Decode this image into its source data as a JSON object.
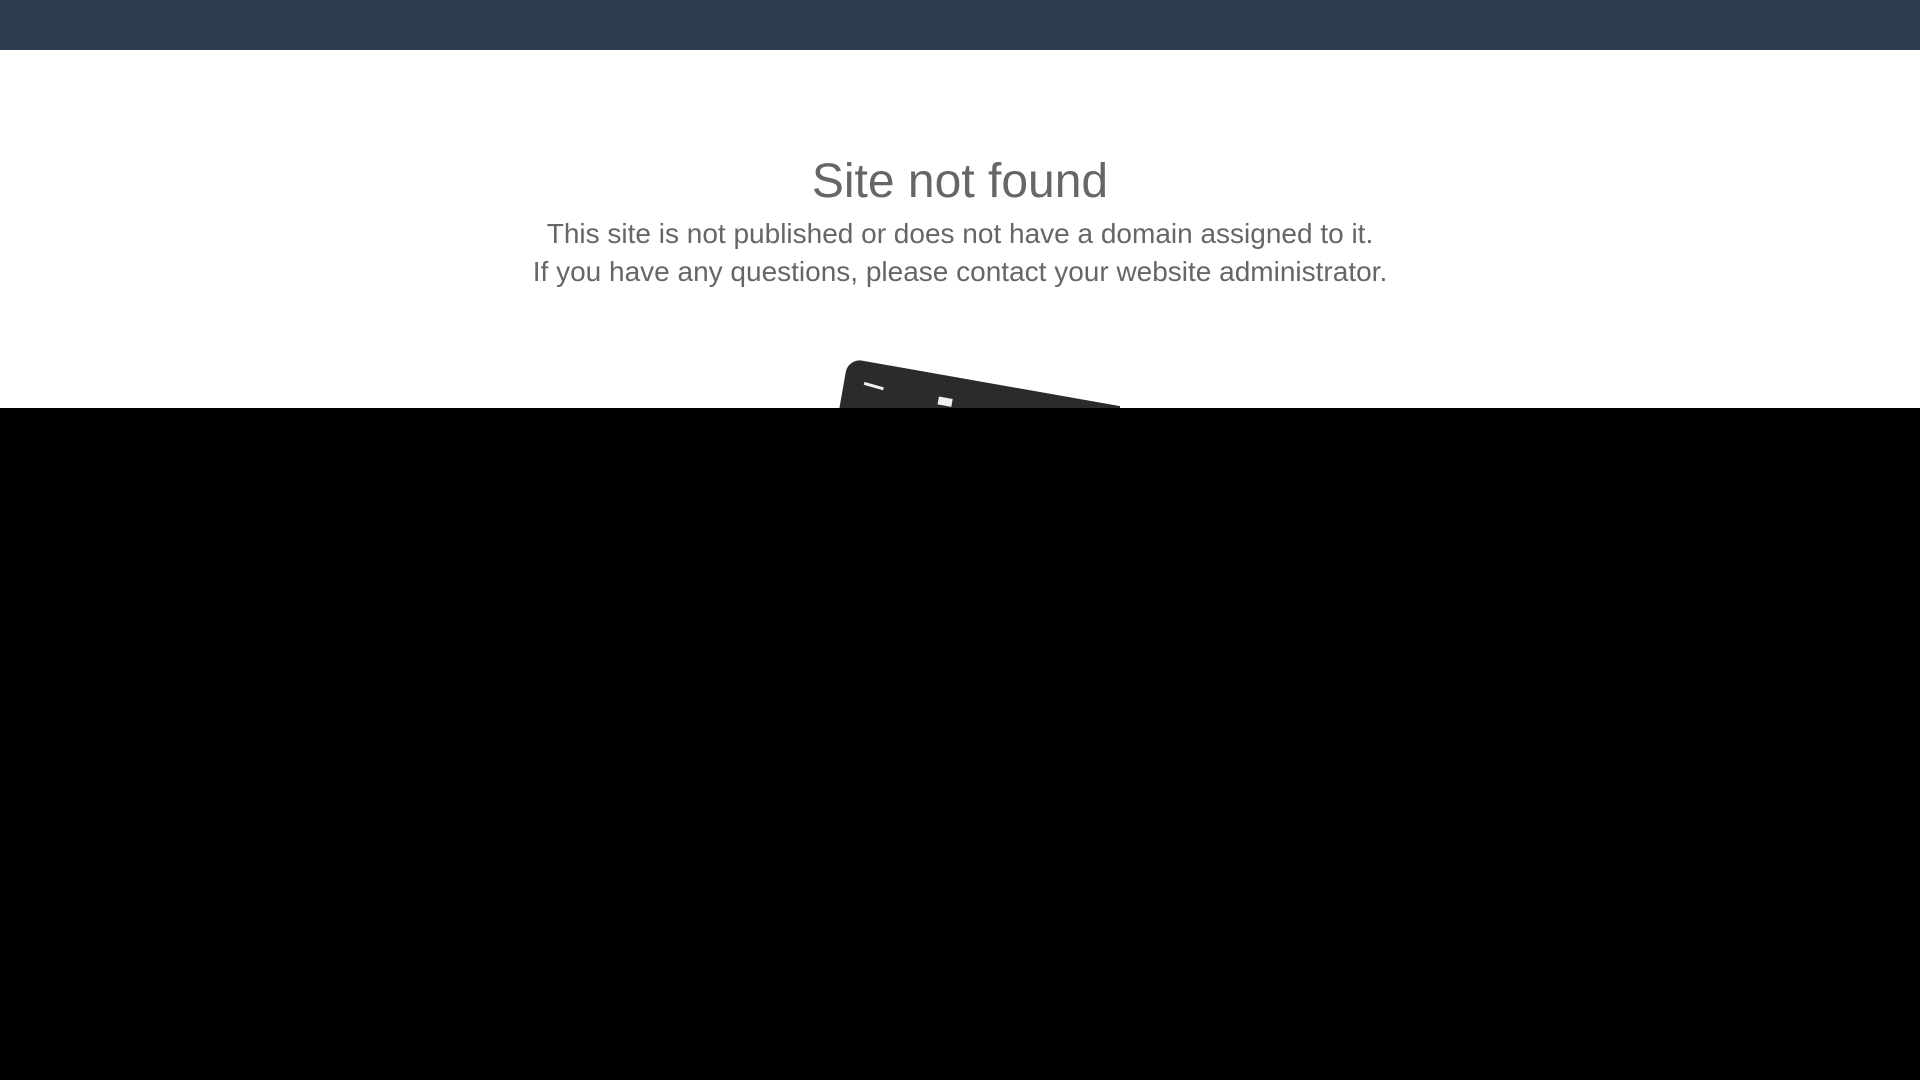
{
  "header": {
    "background_color": "#2e3e51"
  },
  "main": {
    "title": "Site not found",
    "message_line_1": "This site is not published or does not have a domain assigned to it.",
    "message_line_2": "If you have any questions, please contact your website administrator.",
    "text_color": "#666666",
    "illustration_icon": "tilted-sign-icon"
  },
  "overlay": {
    "color": "#000000"
  }
}
